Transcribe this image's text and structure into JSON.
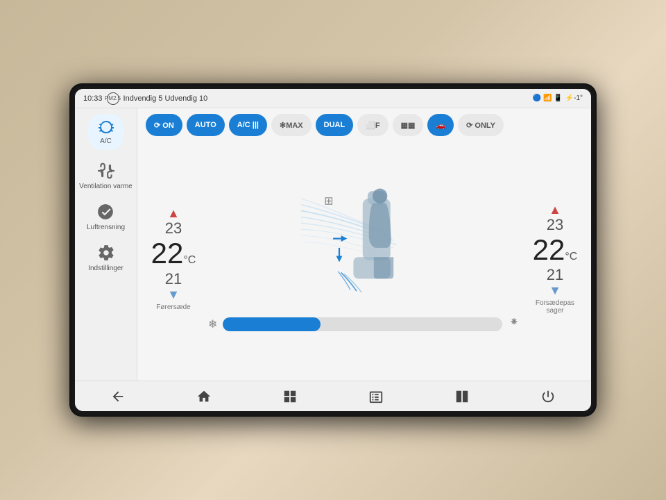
{
  "statusBar": {
    "time": "10:33",
    "pm": "PM2.5",
    "airQuality": "Indvendig 5  Udvendig 10",
    "connectivity": "🔵 📶 📱",
    "battery": "⚡-1°"
  },
  "sidebar": {
    "items": [
      {
        "label": "A/C",
        "active": true
      },
      {
        "label": "Ventilation\nvarme"
      },
      {
        "label": "Luftrensning"
      },
      {
        "label": "Indstillinger"
      }
    ]
  },
  "buttons": {
    "fanOn": "⟳ ON",
    "auto": "AUTO",
    "acMode": "A/C |||",
    "max": "✻MAX",
    "dual": "DUAL",
    "windshield": "⬜F",
    "rearDefrost": "▦▦",
    "carMode": "🚗",
    "fanOnly": "⟳ ONLY"
  },
  "leftTemp": {
    "above": "23",
    "value": "22",
    "below": "21",
    "label": "Førersæde"
  },
  "rightTemp": {
    "above": "23",
    "value": "22",
    "below": "21",
    "label": "Forsædepas\nsager"
  },
  "fanSpeed": {
    "value": 35,
    "min": 0,
    "max": 100
  },
  "bottomNav": {
    "items": [
      "back",
      "home",
      "overview",
      "apps",
      "split",
      "power"
    ]
  }
}
